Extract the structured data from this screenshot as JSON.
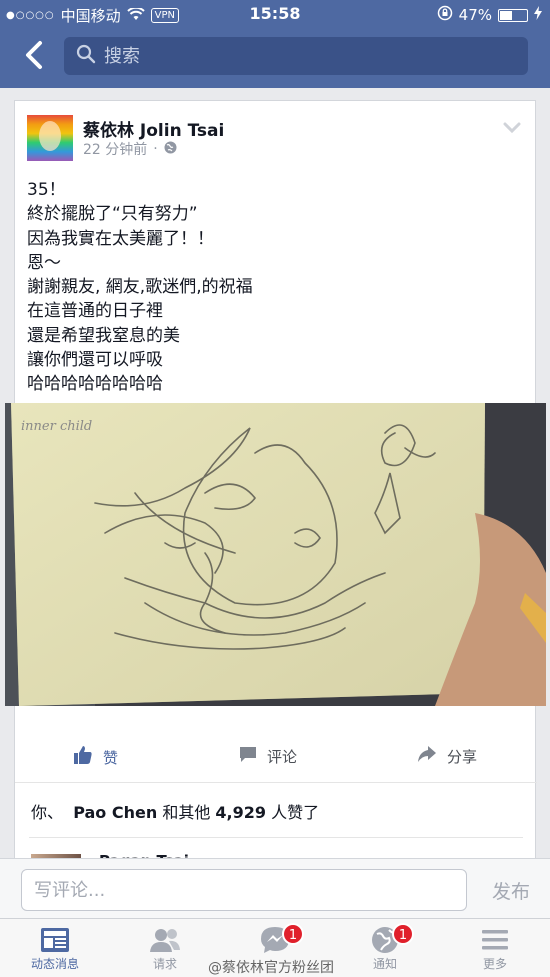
{
  "status_bar": {
    "carrier": "中国移动",
    "vpn": "VPN",
    "time": "15:58",
    "battery": "47%",
    "battery_level": 0.47
  },
  "nav": {
    "search_placeholder": "搜索"
  },
  "post": {
    "author": "蔡依林 Jolin Tsai",
    "time": "22 分钟前",
    "text": "35！\n終於擺脫了“只有努力”\n因為我實在太美麗了！！\n恩～\n謝謝親友, 網友,歌迷們,的祝福\n在這普通的日子裡\n還是希望我窒息的美\n讓你們還可以呼吸\n哈哈哈哈哈哈哈哈",
    "photo_caption": "inner child",
    "actions": {
      "like": "赞",
      "comment": "评论",
      "share": "分享"
    },
    "likes": {
      "you": "你、",
      "name": "Pao Chen",
      "rest": "和其他",
      "count": "4,929",
      "suffix": "人赞了"
    },
    "peek_commenter": "Pagan Tsai"
  },
  "composer": {
    "placeholder": "写评论...",
    "post_label": "发布"
  },
  "tabs": [
    {
      "label": "动态消息",
      "icon": "news-feed-icon",
      "badge": ""
    },
    {
      "label": "请求",
      "icon": "friend-requests-icon",
      "badge": ""
    },
    {
      "label": "",
      "icon": "messenger-icon",
      "badge": "1"
    },
    {
      "label": "通知",
      "icon": "globe-icon",
      "badge": "1"
    },
    {
      "label": "更多",
      "icon": "menu-icon",
      "badge": ""
    }
  ],
  "watermark": "@蔡依林官方粉丝团",
  "colors": {
    "brand": "#4e69a2",
    "badge": "#e0202b"
  }
}
